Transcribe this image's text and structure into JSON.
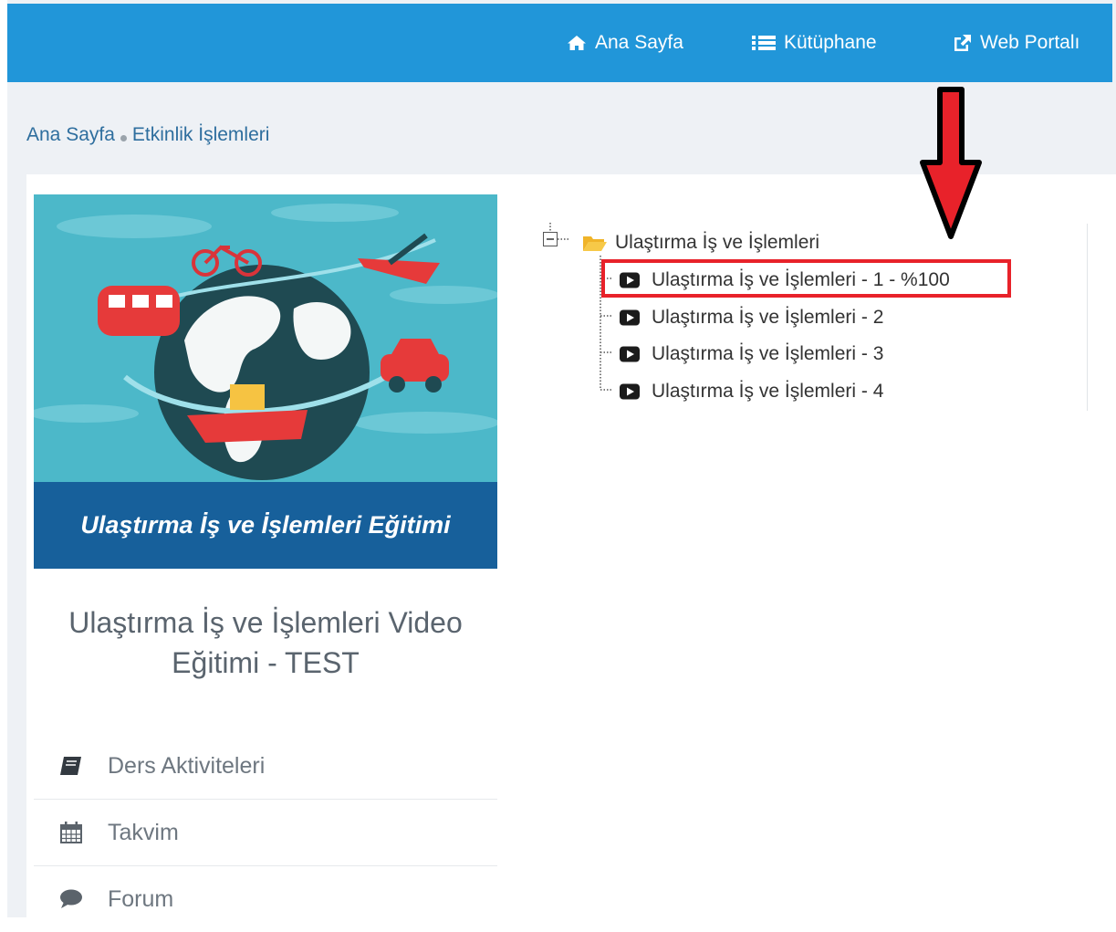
{
  "nav": {
    "home": "Ana Sayfa",
    "library": "Kütüphane",
    "portal": "Web Portalı"
  },
  "breadcrumb": {
    "home": "Ana Sayfa",
    "current": "Etkinlik İşlemleri"
  },
  "course": {
    "image_caption": "Ulaştırma İş ve İşlemleri Eğitimi",
    "title_line1": "Ulaştırma İş ve İşlemleri Video",
    "title_line2": "Eğitimi - TEST"
  },
  "menu": [
    {
      "label": "Ders Aktiviteleri",
      "icon": "book-icon"
    },
    {
      "label": "Takvim",
      "icon": "calendar-icon"
    },
    {
      "label": "Forum",
      "icon": "comment-icon"
    }
  ],
  "tree": {
    "folder": "Ulaştırma İş ve İşlemleri",
    "items": [
      "Ulaştırma İş ve İşlemleri - 1 - %100",
      "Ulaştırma İş ve İşlemleri - 2",
      "Ulaştırma İş ve İşlemleri - 3",
      "Ulaştırma İş ve İşlemleri - 4"
    ]
  },
  "colors": {
    "topbar": "#2196d9",
    "caption_bg": "#17609b",
    "highlight": "#e8222a",
    "folder": "#f0b429"
  }
}
